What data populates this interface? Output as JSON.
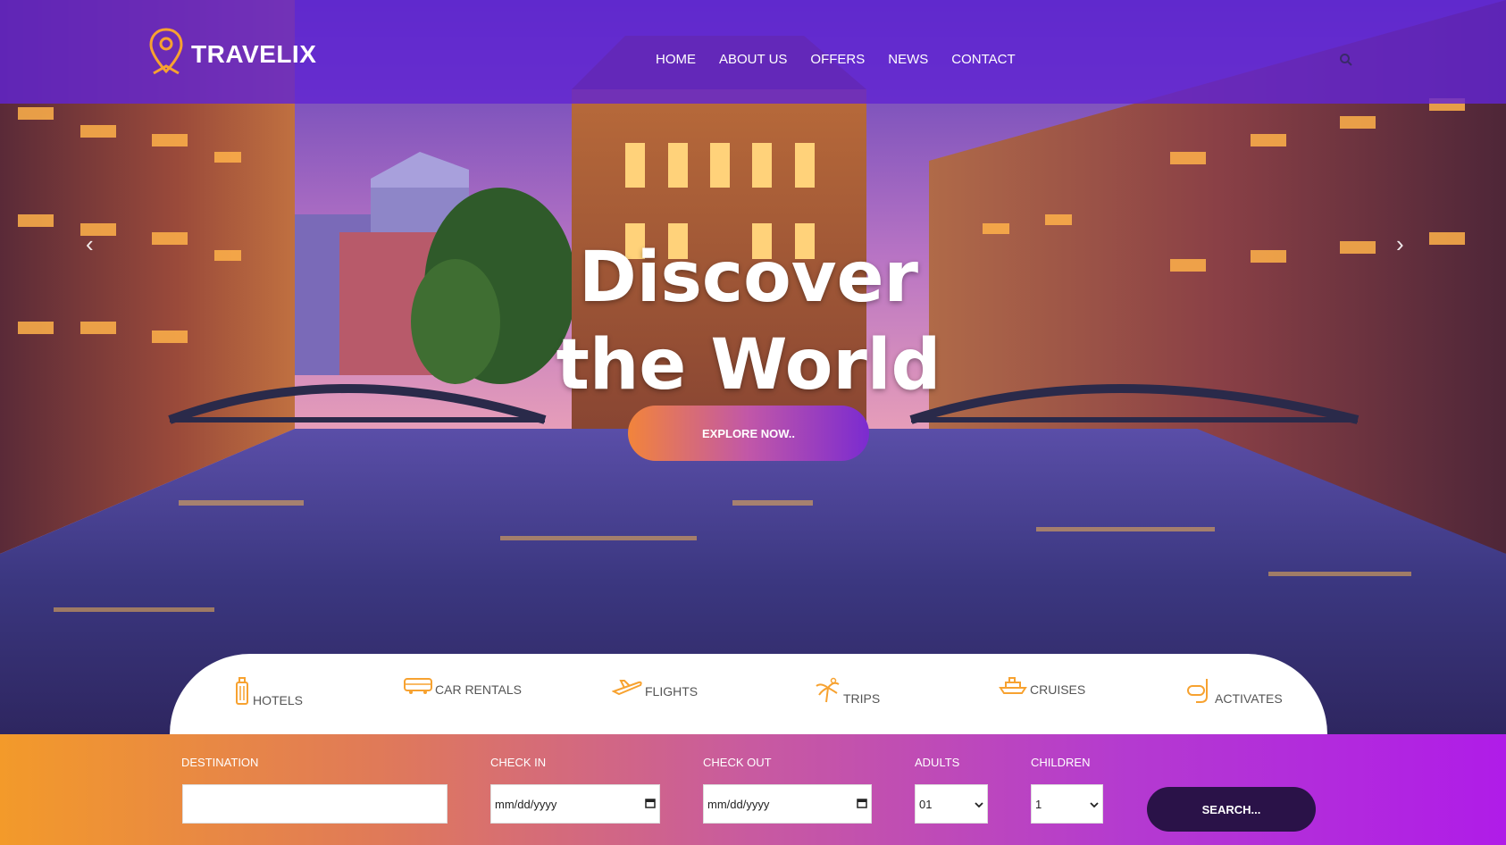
{
  "brand": {
    "name": "TRAVELIX"
  },
  "nav": {
    "items": [
      "HOME",
      "ABOUT US",
      "OFFERS",
      "NEWS",
      "CONTACT"
    ]
  },
  "hero": {
    "line1": "Discover",
    "line2": "the World",
    "cta": "EXPLORE NOW.."
  },
  "tabs": [
    "HOTELS",
    "CAR RENTALS",
    "FLIGHTS",
    "TRIPS",
    "CRUISES",
    "ACTIVATES"
  ],
  "search": {
    "destination_label": "DESTINATION",
    "destination_value": "",
    "checkin_label": "CHECK IN",
    "checkin_placeholder": "mm/dd/yyyy",
    "checkout_label": "CHECK OUT",
    "checkout_placeholder": "mm/dd/yyyy",
    "adults_label": "ADULTS",
    "adults_value": "01",
    "children_label": "CHILDREN",
    "children_value": "1",
    "button": "SEARCH..."
  },
  "colors": {
    "nav_overlay": "#6224d2",
    "accent_orange": "#f39a2a",
    "accent_purple": "#b01ce8",
    "search_button": "#2a1248"
  },
  "icons": [
    "location-pin-icon",
    "search-icon",
    "chevron-left-icon",
    "chevron-right-icon",
    "suitcase-icon",
    "bus-icon",
    "airplane-icon",
    "island-icon",
    "ship-icon",
    "snorkel-icon",
    "calendar-icon",
    "chevron-down-icon"
  ]
}
